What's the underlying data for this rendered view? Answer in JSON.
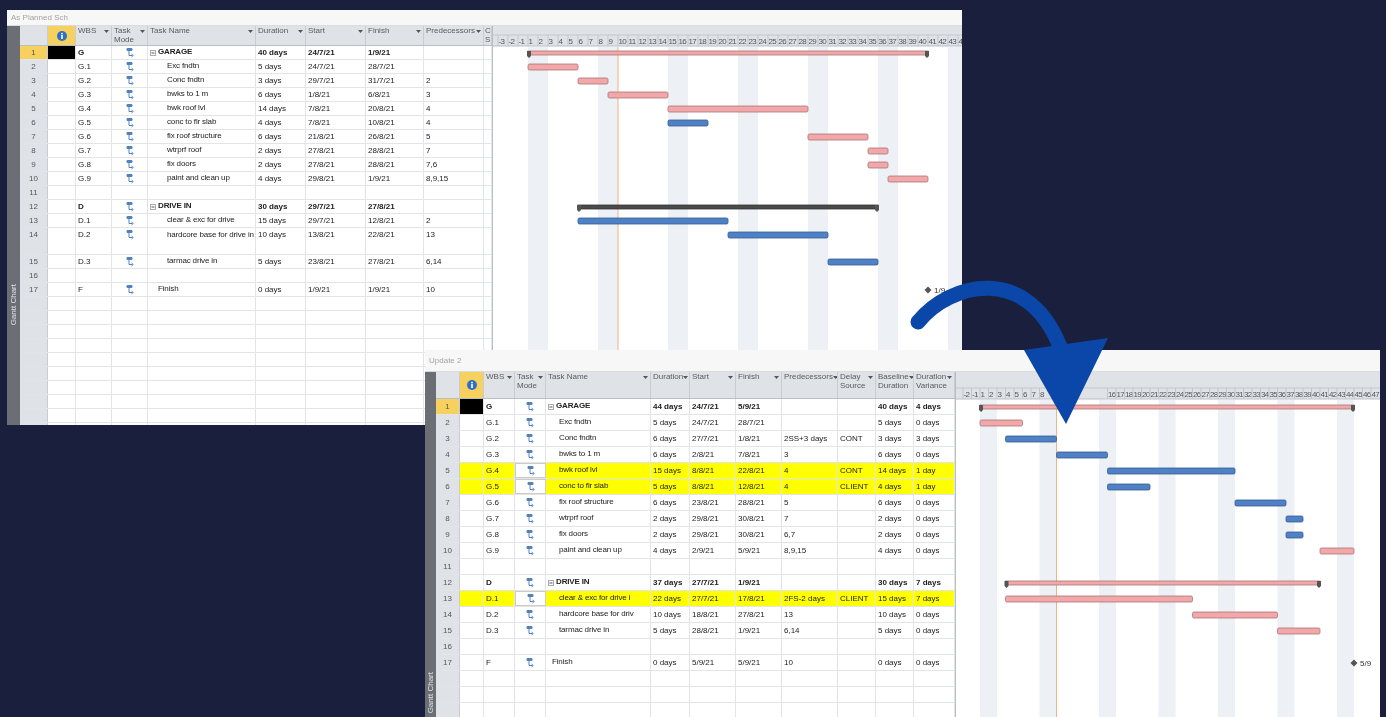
{
  "windows": [
    {
      "title": "As Planned Sch",
      "view_label": "Gantt Chart",
      "table": {
        "columns": [
          {
            "label": "WBS"
          },
          {
            "label": "Task Mode"
          },
          {
            "label": "Task Name"
          },
          {
            "label": "Duration"
          },
          {
            "label": "Start"
          },
          {
            "label": "Finish"
          },
          {
            "label": "Predecessors"
          },
          {
            "label": "C S"
          }
        ],
        "rows": [
          {
            "id": "1",
            "kind": "summary",
            "wbs": "G",
            "name": "GARAGE",
            "duration": "40 days",
            "start": "24/7/21",
            "finish": "1/9/21",
            "selected": true,
            "expanded": true,
            "critical": true,
            "children": [
              {
                "id": "2",
                "kind": "task",
                "wbs": "G.1",
                "name": "Exc fndtn",
                "duration": "5 days",
                "start": "24/7/21",
                "finish": "28/7/21",
                "selected": false,
                "critical": true
              },
              {
                "id": "3",
                "kind": "task",
                "wbs": "G.2",
                "name": "Conc fndtn",
                "duration": "3 days",
                "start": "29/7/21",
                "finish": "31/7/21",
                "predecessors": "2",
                "selected": false,
                "critical": true
              },
              {
                "id": "4",
                "kind": "task",
                "wbs": "G.3",
                "name": "bwks to 1 m",
                "duration": "6 days",
                "start": "1/8/21",
                "finish": "6/8/21",
                "predecessors": "3",
                "selected": false,
                "critical": true
              },
              {
                "id": "5",
                "kind": "task",
                "wbs": "G.4",
                "name": "bwk roof lvl",
                "duration": "14 days",
                "start": "7/8/21",
                "finish": "20/8/21",
                "predecessors": "4",
                "selected": false,
                "critical": true
              },
              {
                "id": "6",
                "kind": "task",
                "wbs": "G.5",
                "name": "conc to flr slab",
                "duration": "4 days",
                "start": "7/8/21",
                "finish": "10/8/21",
                "predecessors": "4",
                "selected": false,
                "critical": false
              },
              {
                "id": "7",
                "kind": "task",
                "wbs": "G.6",
                "name": "fix roof structure",
                "duration": "6 days",
                "start": "21/8/21",
                "finish": "26/8/21",
                "predecessors": "5",
                "selected": false,
                "critical": true
              },
              {
                "id": "8",
                "kind": "task",
                "wbs": "G.7",
                "name": "wtrprf roof",
                "duration": "2 days",
                "start": "27/8/21",
                "finish": "28/8/21",
                "predecessors": "7",
                "selected": false,
                "critical": true
              },
              {
                "id": "9",
                "kind": "task",
                "wbs": "G.8",
                "name": "fix doors",
                "duration": "2 days",
                "start": "27/8/21",
                "finish": "28/8/21",
                "predecessors": "7,6",
                "selected": false,
                "critical": true
              },
              {
                "id": "10",
                "kind": "task",
                "wbs": "G.9",
                "name": "paint and clean up",
                "duration": "4 days",
                "start": "29/8/21",
                "finish": "1/9/21",
                "predecessors": "8,9,15",
                "selected": false,
                "critical": true
              }
            ]
          },
          {
            "id": "11",
            "kind": "blank",
            "selected": false
          },
          {
            "id": "12",
            "kind": "summary",
            "wbs": "D",
            "name": "DRIVE IN",
            "duration": "30 days",
            "start": "29/7/21",
            "finish": "27/8/21",
            "selected": false,
            "expanded": true,
            "critical": false,
            "children": [
              {
                "id": "13",
                "kind": "task",
                "wbs": "D.1",
                "name": "clear & exc for drive",
                "duration": "15 days",
                "start": "29/7/21",
                "finish": "12/8/21",
                "predecessors": "2",
                "selected": false,
                "critical": false
              },
              {
                "id": "14",
                "kind": "task",
                "wbs": "D.2",
                "name": "hardcore base for drive in",
                "duration": "10 days",
                "start": "13/8/21",
                "finish": "22/8/21",
                "predecessors": "13",
                "selected": false,
                "critical": false
              },
              {
                "id": "15",
                "kind": "task",
                "wbs": "D.3",
                "name": "tarmac drive in",
                "duration": "5 days",
                "start": "23/8/21",
                "finish": "27/8/21",
                "predecessors": "6,14",
                "selected": false,
                "critical": false
              }
            ]
          },
          {
            "id": "16",
            "kind": "blank",
            "selected": false
          },
          {
            "id": "17",
            "kind": "milestone",
            "wbs": "F",
            "name": "Finish",
            "duration": "0 days",
            "start": "1/9/21",
            "finish": "1/9/21",
            "predecessors": "10",
            "selected": false,
            "bar_label": "1/9"
          }
        ]
      },
      "gantt": {
        "timescale": [
          "-3",
          "-2",
          "-1",
          "1",
          "2",
          "3",
          "4",
          "5",
          "6",
          "7",
          "8",
          "9",
          "10",
          "11",
          "12",
          "13",
          "14",
          "15",
          "16",
          "17",
          "18",
          "19",
          "20",
          "21",
          "22",
          "23",
          "24",
          "25",
          "26",
          "27",
          "28",
          "29",
          "30",
          "31",
          "32",
          "33",
          "34",
          "35",
          "36",
          "37",
          "38",
          "39",
          "40",
          "41",
          "42",
          "43",
          "4"
        ]
      }
    },
    {
      "title": "Update 2",
      "view_label": "Gantt Chart",
      "table": {
        "columns": [
          {
            "label": "WBS"
          },
          {
            "label": "Task Mode"
          },
          {
            "label": "Task Name"
          },
          {
            "label": "Duration"
          },
          {
            "label": "Start"
          },
          {
            "label": "Finish"
          },
          {
            "label": "Predecessors"
          },
          {
            "label": "Delay Source"
          },
          {
            "label": "Baseline Duration"
          },
          {
            "label": "Duration Variance"
          }
        ],
        "rows": [
          {
            "id": "1",
            "kind": "summary",
            "wbs": "G",
            "name": "GARAGE",
            "duration": "44 days",
            "start": "24/7/21",
            "finish": "5/9/21",
            "baseline_duration": "40 days",
            "duration_variance": "4 days",
            "selected": true,
            "highlighted": false,
            "expanded": true,
            "critical": true,
            "children": [
              {
                "id": "2",
                "kind": "task",
                "wbs": "G.1",
                "name": "Exc fndtn",
                "duration": "5 days",
                "start": "24/7/21",
                "finish": "28/7/21",
                "baseline_duration": "5 days",
                "duration_variance": "0 days",
                "selected": false,
                "highlighted": false,
                "critical": true
              },
              {
                "id": "3",
                "kind": "task",
                "wbs": "G.2",
                "name": "Conc fndtn",
                "duration": "6 days",
                "start": "27/7/21",
                "finish": "1/8/21",
                "predecessors": "2SS+3 days",
                "delay_source": "CONT",
                "baseline_duration": "3 days",
                "duration_variance": "3 days",
                "selected": false,
                "highlighted": false,
                "critical": false
              },
              {
                "id": "4",
                "kind": "task",
                "wbs": "G.3",
                "name": "bwks to 1 m",
                "duration": "6 days",
                "start": "2/8/21",
                "finish": "7/8/21",
                "predecessors": "3",
                "baseline_duration": "6 days",
                "duration_variance": "0 days",
                "selected": false,
                "highlighted": false,
                "critical": false
              },
              {
                "id": "5",
                "kind": "task",
                "wbs": "G.4",
                "name": "bwk roof lvl",
                "duration": "15 days",
                "start": "8/8/21",
                "finish": "22/8/21",
                "predecessors": "4",
                "delay_source": "CONT",
                "baseline_duration": "14 days",
                "duration_variance": "1 day",
                "selected": false,
                "highlighted": true,
                "critical": false
              },
              {
                "id": "6",
                "kind": "task",
                "wbs": "G.5",
                "name": "conc to flr slab",
                "duration": "5 days",
                "start": "8/8/21",
                "finish": "12/8/21",
                "predecessors": "4",
                "delay_source": "CLIENT",
                "baseline_duration": "4 days",
                "duration_variance": "1 day",
                "selected": false,
                "highlighted": true,
                "critical": false
              },
              {
                "id": "7",
                "kind": "task",
                "wbs": "G.6",
                "name": "fix roof structure",
                "duration": "6 days",
                "start": "23/8/21",
                "finish": "28/8/21",
                "predecessors": "5",
                "baseline_duration": "6 days",
                "duration_variance": "0 days",
                "selected": false,
                "highlighted": false,
                "critical": false
              },
              {
                "id": "8",
                "kind": "task",
                "wbs": "G.7",
                "name": "wtrprf roof",
                "duration": "2 days",
                "start": "29/8/21",
                "finish": "30/8/21",
                "predecessors": "7",
                "baseline_duration": "2 days",
                "duration_variance": "0 days",
                "selected": false,
                "highlighted": false,
                "critical": false
              },
              {
                "id": "9",
                "kind": "task",
                "wbs": "G.8",
                "name": "fix doors",
                "duration": "2 days",
                "start": "29/8/21",
                "finish": "30/8/21",
                "predecessors": "6,7",
                "baseline_duration": "2 days",
                "duration_variance": "0 days",
                "selected": false,
                "highlighted": false,
                "critical": false
              },
              {
                "id": "10",
                "kind": "task",
                "wbs": "G.9",
                "name": "paint and clean up",
                "duration": "4 days",
                "start": "2/9/21",
                "finish": "5/9/21",
                "predecessors": "8,9,15",
                "baseline_duration": "4 days",
                "duration_variance": "0 days",
                "selected": false,
                "highlighted": false,
                "critical": true
              }
            ]
          },
          {
            "id": "11",
            "kind": "blank",
            "selected": false,
            "highlighted": false
          },
          {
            "id": "12",
            "kind": "summary",
            "wbs": "D",
            "name": "DRIVE IN",
            "duration": "37 days",
            "start": "27/7/21",
            "finish": "1/9/21",
            "baseline_duration": "30 days",
            "duration_variance": "7 days",
            "selected": false,
            "highlighted": false,
            "expanded": true,
            "critical": true,
            "children": [
              {
                "id": "13",
                "kind": "task",
                "wbs": "D.1",
                "name": "clear & exc for drive i",
                "duration": "22 days",
                "start": "27/7/21",
                "finish": "17/8/21",
                "predecessors": "2FS-2 days",
                "delay_source": "CLIENT",
                "baseline_duration": "15 days",
                "duration_variance": "7 days",
                "selected": false,
                "highlighted": true,
                "critical": true
              },
              {
                "id": "14",
                "kind": "task",
                "wbs": "D.2",
                "name": "hardcore base for driv",
                "duration": "10 days",
                "start": "18/8/21",
                "finish": "27/8/21",
                "predecessors": "13",
                "baseline_duration": "10 days",
                "duration_variance": "0 days",
                "selected": false,
                "highlighted": false,
                "critical": true
              },
              {
                "id": "15",
                "kind": "task",
                "wbs": "D.3",
                "name": "tarmac drive in",
                "duration": "5 days",
                "start": "28/8/21",
                "finish": "1/9/21",
                "predecessors": "6,14",
                "baseline_duration": "5 days",
                "duration_variance": "0 days",
                "selected": false,
                "highlighted": false,
                "critical": true
              }
            ]
          },
          {
            "id": "16",
            "kind": "blank",
            "selected": false,
            "highlighted": false
          },
          {
            "id": "17",
            "kind": "milestone",
            "wbs": "F",
            "name": "Finish",
            "duration": "0 days",
            "start": "5/9/21",
            "finish": "5/9/21",
            "predecessors": "10",
            "baseline_duration": "0 days",
            "duration_variance": "0 days",
            "selected": false,
            "highlighted": false,
            "bar_label": "5/9"
          }
        ]
      },
      "gantt": {
        "timescale": [
          "-2",
          "-1",
          "1",
          "2",
          "3",
          "4",
          "5",
          "6",
          "7",
          "8",
          "16",
          "17",
          "18",
          "19",
          "20",
          "21",
          "22",
          "23",
          "24",
          "25",
          "26",
          "27",
          "28",
          "29",
          "30",
          "31",
          "32",
          "33",
          "34",
          "35",
          "36",
          "37",
          "38",
          "39",
          "40",
          "41",
          "42",
          "43",
          "44",
          "45",
          "46",
          "47"
        ]
      }
    }
  ]
}
